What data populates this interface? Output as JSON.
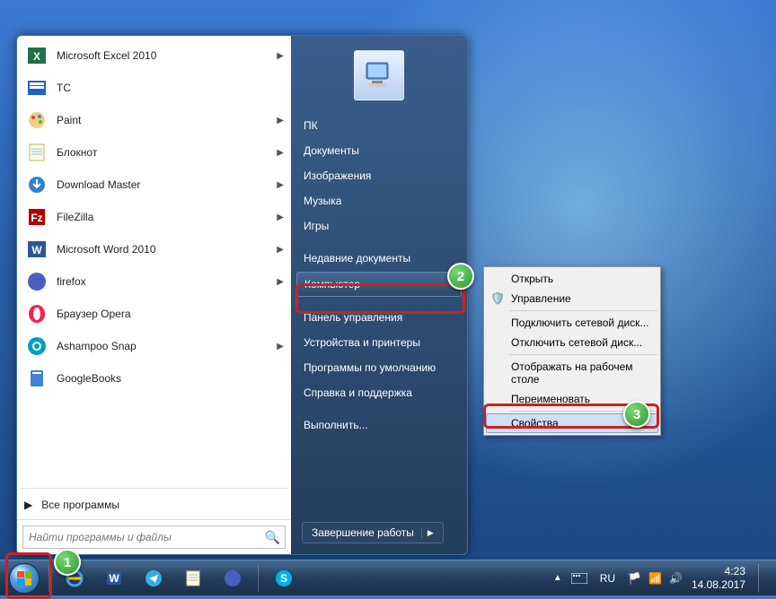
{
  "programs": [
    {
      "label": "Microsoft Excel 2010",
      "icon": "excel",
      "arrow": true
    },
    {
      "label": "TC",
      "icon": "tc",
      "arrow": false
    },
    {
      "label": "Paint",
      "icon": "paint",
      "arrow": true
    },
    {
      "label": "Блокнот",
      "icon": "notepad",
      "arrow": true
    },
    {
      "label": "Download Master",
      "icon": "dm",
      "arrow": true
    },
    {
      "label": "FileZilla",
      "icon": "fz",
      "arrow": true
    },
    {
      "label": "Microsoft Word 2010",
      "icon": "word",
      "arrow": true
    },
    {
      "label": "firefox",
      "icon": "ff",
      "arrow": true
    },
    {
      "label": "Браузер Opera",
      "icon": "opera",
      "arrow": false
    },
    {
      "label": "Ashampoo Snap",
      "icon": "snap",
      "arrow": true
    },
    {
      "label": "GoogleBooks",
      "icon": "gb",
      "arrow": false
    }
  ],
  "all_programs": "Все программы",
  "search_placeholder": "Найти программы и файлы",
  "right_items": [
    {
      "label": "ПК",
      "hi": false
    },
    {
      "label": "Документы",
      "hi": false
    },
    {
      "label": "Изображения",
      "hi": false
    },
    {
      "label": "Музыка",
      "hi": false
    },
    {
      "label": "Игры",
      "hi": false
    },
    {
      "label": "Недавние документы",
      "hi": false
    },
    {
      "label": "Компьютер",
      "hi": true
    },
    {
      "label": "Панель управления",
      "hi": false
    },
    {
      "label": "Устройства и принтеры",
      "hi": false
    },
    {
      "label": "Программы по умолчанию",
      "hi": false
    },
    {
      "label": "Справка и поддержка",
      "hi": false
    },
    {
      "label": "Выполнить...",
      "hi": false
    }
  ],
  "shutdown": "Завершение работы",
  "context_menu": [
    {
      "label": "Открыть",
      "icon": "",
      "sep": false,
      "hi": false
    },
    {
      "label": "Управление",
      "icon": "shield",
      "sep": false,
      "hi": false
    },
    {
      "label": "",
      "icon": "",
      "sep": true,
      "hi": false
    },
    {
      "label": "Подключить сетевой диск...",
      "icon": "",
      "sep": false,
      "hi": false
    },
    {
      "label": "Отключить сетевой диск...",
      "icon": "",
      "sep": false,
      "hi": false
    },
    {
      "label": "",
      "icon": "",
      "sep": true,
      "hi": false
    },
    {
      "label": "Отображать на рабочем столе",
      "icon": "",
      "sep": false,
      "hi": false
    },
    {
      "label": "Переименовать",
      "icon": "",
      "sep": false,
      "hi": false
    },
    {
      "label": "",
      "icon": "",
      "sep": true,
      "hi": false
    },
    {
      "label": "Свойства",
      "icon": "",
      "sep": false,
      "hi": true
    }
  ],
  "badges": {
    "b1": "1",
    "b2": "2",
    "b3": "3"
  },
  "tray": {
    "lang": "RU",
    "time": "4:23",
    "date": "14.08.2017"
  }
}
